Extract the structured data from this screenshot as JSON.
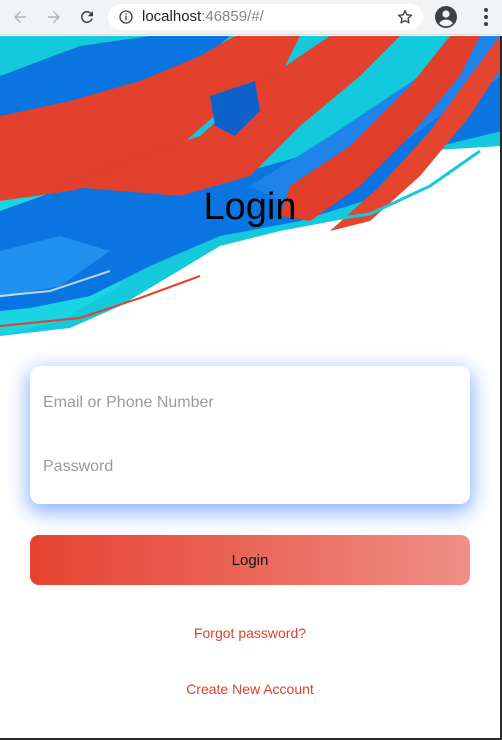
{
  "browser": {
    "url_host": "localhost",
    "url_rest": ":46859/#/",
    "icons": {
      "back": "back-arrow-icon",
      "forward": "forward-arrow-icon",
      "reload": "reload-icon",
      "info": "info-icon",
      "bookmark": "star-icon",
      "profile": "account-circle-icon",
      "menu": "more-vert-icon"
    }
  },
  "page": {
    "title": "Login",
    "email_placeholder": "Email or Phone Number",
    "password_placeholder": "Password",
    "login_button": "Login",
    "forgot_password": "Forgot password?",
    "create_account": "Create New Account"
  },
  "colors": {
    "brush_red": "#e2412d",
    "brush_blue": "#0a74e0",
    "brush_cyan": "#14c9dc",
    "link": "#d9432f",
    "card_shadow": "#2a6dff"
  }
}
